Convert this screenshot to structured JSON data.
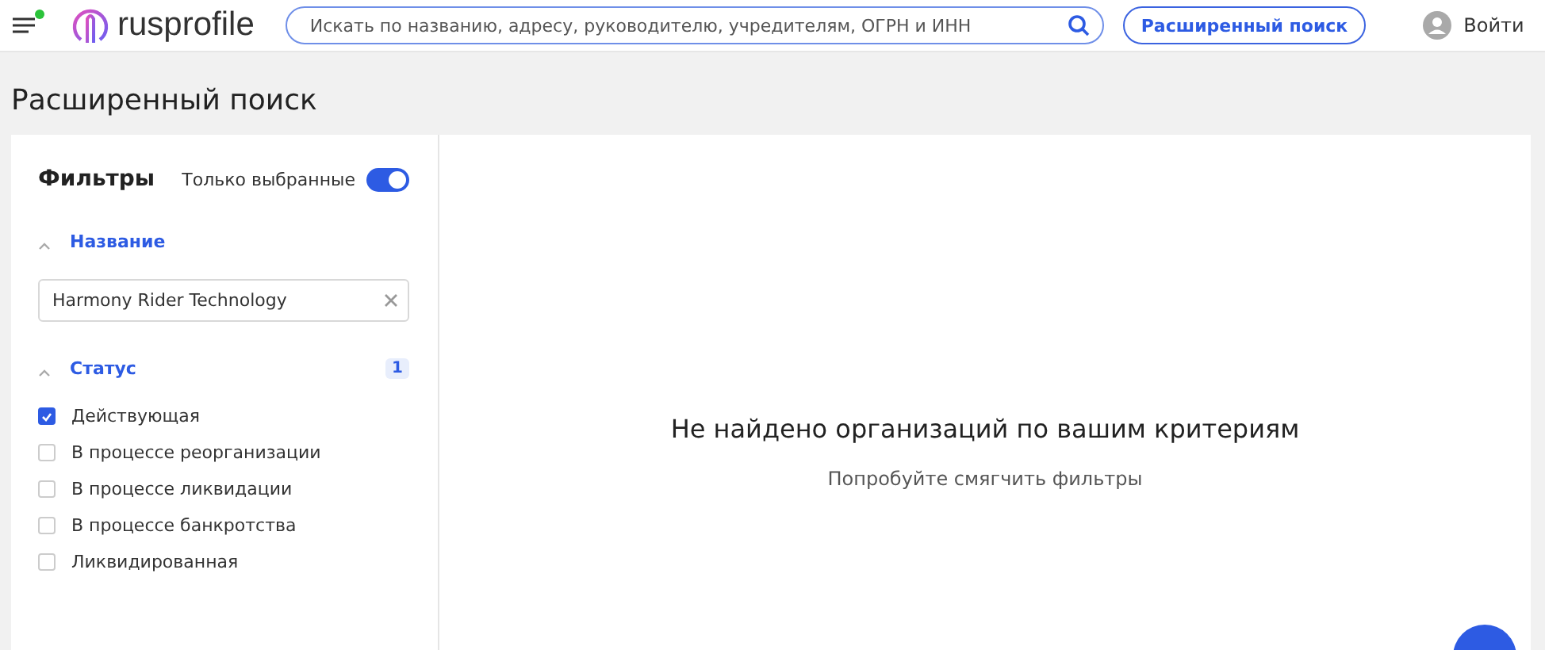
{
  "header": {
    "logo": "rusprofile",
    "notification_dot": true,
    "search": {
      "placeholder": "Искать по названию, адресу, руководителю, учредителям, ОГРН и ИНН"
    },
    "advanced_button": "Расширенный поиск",
    "login": "Войти"
  },
  "page_title": "Расширенный поиск",
  "filters": {
    "title": "Фильтры",
    "only_selected": {
      "label": "Только выбранные",
      "on": true
    },
    "sections": [
      {
        "kind": "text",
        "title": "Название",
        "expanded": true,
        "value": "Harmony Rider Technology"
      },
      {
        "kind": "checklist",
        "title": "Статус",
        "expanded": true,
        "count": "1",
        "options": [
          {
            "label": "Действующая",
            "checked": true
          },
          {
            "label": "В процессе реорганизации",
            "checked": false
          },
          {
            "label": "В процессе ликвидации",
            "checked": false
          },
          {
            "label": "В процессе банкротства",
            "checked": false
          },
          {
            "label": "Ликвидированная",
            "checked": false
          }
        ]
      }
    ]
  },
  "results": {
    "empty_title": "Не найдено организаций по вашим критериям",
    "empty_hint": "Попробуйте смягчить фильтры"
  }
}
